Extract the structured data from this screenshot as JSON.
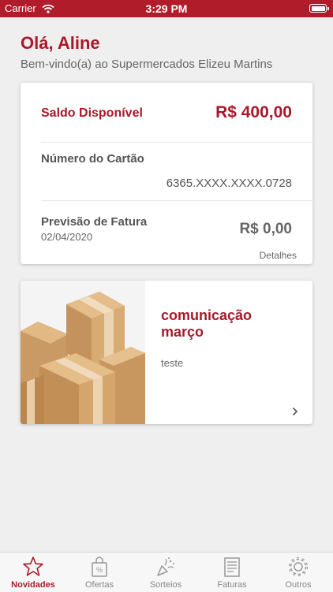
{
  "statusbar": {
    "carrier": "Carrier",
    "time": "3:29 PM"
  },
  "greeting": "Olá, Aline",
  "subtitle": "Bem-vindo(a) ao Supermercados Elizeu Martins",
  "balance_card": {
    "balance_label": "Saldo Disponível",
    "balance_value": "R$ 400,00",
    "card_number_label": "Número do Cartão",
    "card_number": "6365.XXXX.XXXX.0728",
    "invoice_label": "Previsão de Fatura",
    "invoice_date": "02/04/2020",
    "invoice_value": "R$ 0,00",
    "details_link": "Detalhes"
  },
  "promo_card": {
    "title": "comunicação março",
    "text": "teste",
    "image_icon": "boxes-image"
  },
  "tabbar": [
    {
      "label": "Novidades",
      "icon": "star-icon",
      "active": true
    },
    {
      "label": "Ofertas",
      "icon": "offers-bag-icon",
      "active": false
    },
    {
      "label": "Sorteios",
      "icon": "confetti-icon",
      "active": false
    },
    {
      "label": "Faturas",
      "icon": "invoice-icon",
      "active": false
    },
    {
      "label": "Outros",
      "icon": "gear-icon",
      "active": false
    }
  ],
  "colors": {
    "accent": "#a8192b",
    "statusbar": "#b01c2a",
    "background": "#efefef"
  }
}
